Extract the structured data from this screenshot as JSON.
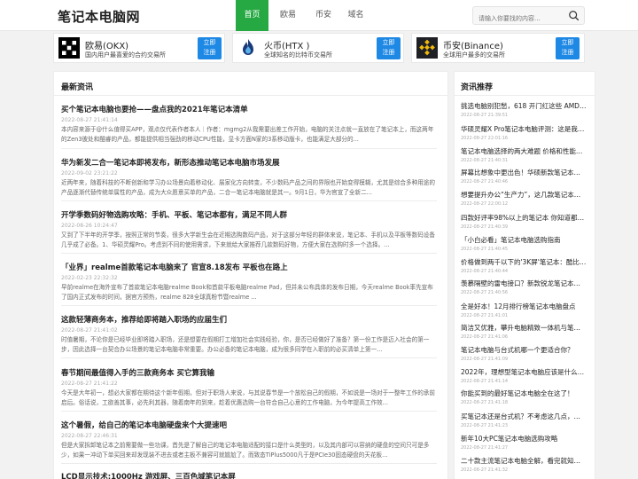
{
  "site": {
    "logo": "笔记本电脑网"
  },
  "nav": {
    "items": [
      "首页",
      "欧易",
      "币安",
      "域名"
    ]
  },
  "search": {
    "placeholder": "请输入你要找的内容..."
  },
  "exchanges": [
    {
      "name": "欧易(OKX)",
      "desc": "国内用户最喜爱的合约交易所",
      "button": [
        "立即",
        "注册"
      ]
    },
    {
      "name": "火币(HTX )",
      "desc": "全球知名的比特币交易所",
      "button": [
        "立即",
        "注册"
      ]
    },
    {
      "name": "币安(Binance)",
      "desc": "全球用户最多的交易所",
      "button": [
        "立即",
        "注册"
      ]
    }
  ],
  "latest": {
    "title": "最新资讯",
    "articles": [
      {
        "title": "买个笔记本电脑也要抢——盘点我的2021年笔记本清单",
        "date": "2022-08-27 21:41:14",
        "summary": "本内容来源于@什么值得买APP，观点仅代表作者本人｜作者：mgmg2从我需要出差工作开始，电脑的关注点就一直放在了笔记本上，而这两年的Zen3彼处和酷睿的产品，都能提供相当强劲的移动CPU性能，显卡方面N家的3系移动版卡，也能满足大部分的..."
      },
      {
        "title": "华为新发二合一笔记本即将发布，新形态推动笔记本电脑市场发展",
        "date": "2022-09-02 23:21:22",
        "summary": "近两年来，随着科技的不断创新和学习办公场景向着移动化、展家化方向转变，不少数码产品之间的界限也开始变得模糊，尤其是综合多种用途的产品逐渐代替传统单属性的产品，成为大众愿意买单的产品，二合一笔记本电脑就是其一。9月1日，华为官宣了全新二..."
      },
      {
        "title": "开学季数码好物选购攻略：手机、平板、笔记本都有，满足不同人群",
        "date": "2022-08-26 10:24:47",
        "summary": "又到了下半年的开学季，按照正常的节奏，很多大学新生会在近期选购数码产品，对于这部分年轻的群体来说，笔记本、手机以及平板等数码设备几乎成了必备。1、华硕灵耀Pro。考虑到不同的使用需求，下来就给大家推荐几款数码好物，方便大家在选购时多一个选择。..."
      },
      {
        "title": "「业界」realme首款笔记本电脑来了 官宣8.18发布 平板也在路上",
        "date": "2022-02-23 22:32:32",
        "summary": "早前realme在海外宣布了首款笔记本电脑realme Book和首款平板电脑realme Pad，但并未公布具体的发布日期，今天realme Book率先宣布了国内正式发布的时间，据官方预热，realme 828全球真粉节暨realme ..."
      },
      {
        "title": "这款轻薄商务本，推荐给即将踏入职场的应届生们",
        "date": "2022-08-27 21:41:02",
        "summary": "时值暑期，不论你是已经毕业即将踏入职场，还是想要在假期打工增加社会实践经验，你，是否已经做好了准备？第一份工作是迈入社会的第一步，因此选择一台契合办公场景的笔记本电脑非常重要。办公必备的笔记本电脑，成为很多同学在入职前的必买清单上第一..."
      },
      {
        "title": "春节期间最值得入手的三款商务本 买它算我输",
        "date": "2022-08-27 21:41:22",
        "summary": "今天是大年初一，想必大家都在期待这个新年假期，但对于职场人来说，与其说春节是一个放松自己的假期，不如说是一场对于一整年工作的承前启后。俗话说，工欲善其事，必先利其器，随着南年的到来，趁着优惠选购一台符合自己心意的工作电脑，为今年提高工作效..."
      },
      {
        "title": "这个暑假，给自己的笔记本电脑硬盘来个大提速吧",
        "date": "2022-08-27 22:46:31",
        "summary": "但是大家拆卸笔记本之前需要做一些功课，首先是了解自己的笔记本电脑适配的接口是什么类型的，以及其内部可以容纳的硬盘的空间只可是多少，如果一冲动下单买回来却发现装不进去或者主板不兼容可就尴尬了。而致态TiPlus5000凡于是PCIe30固态硬盘的天花板..."
      },
      {
        "title": "LCD显示技术:1000Hz 游戏屏、三百色域笔记本屏",
        "date": "",
        "summary": ""
      }
    ]
  },
  "recommend": {
    "title": "资讯推荐",
    "items": [
      {
        "title": "挑选电脑别犯愁，618 开门红这些 AMD笔记本...",
        "date": "2022-08-27 21:39:51"
      },
      {
        "title": "华硕灵耀X Pro笔记本电脑评测：这是我见过...",
        "date": "2022-08-27 22:01:16"
      },
      {
        "title": "笔记本电脑选择的两大难题 价格和性能如何权衡",
        "date": "2022-08-27 21:40:31"
      },
      {
        "title": "屏幕比想象中更出色！华硕新款笔记本电脑体...",
        "date": "2022-08-27 21:40:46"
      },
      {
        "title": "想要提升办公“生产力”，这几款笔记本电脑...",
        "date": "2022-08-27 22:00:12"
      },
      {
        "title": "四款好评率98%以上的笔记本 你知道都有哪些...",
        "date": "2022-08-27 21:40:39"
      },
      {
        "title": "「小白必看」笔记本电脑选购指南",
        "date": "2022-08-27 21:40:45"
      },
      {
        "title": "价格做到两千以下的'3K屏'笔记本：酷比魔方...",
        "date": "2022-08-27 21:40:44"
      },
      {
        "title": "羡慕隔壁的雷电接口？新款锐龙笔记本电脑安排...",
        "date": "2022-08-27 21:40:56"
      },
      {
        "title": "全是好本！12月排行榜笔记本电脑盘点",
        "date": "2022-08-27 21:41:01"
      },
      {
        "title": "简洁又优雅，攀升电脑精致一体机与笔记本电脑...",
        "date": "2022-08-27 21:41:06"
      },
      {
        "title": "笔记本电脑与台式机哪一个更适合你？",
        "date": "2022-08-27 21:41:09"
      },
      {
        "title": "2022年，理想型笔记本电脑应该是什么样的？",
        "date": "2022-08-27 21:41:14"
      },
      {
        "title": "你能买到的最好笔记本电脑全在这了！",
        "date": "2022-08-27 21:41:18"
      },
      {
        "title": "买笔记本还是台式机？不考虑这几点，买了也是白买",
        "date": "2022-08-27 21:41:23"
      },
      {
        "title": "新年10大PC笔记本电脑选购攻略",
        "date": "2022-08-27 21:41:27"
      },
      {
        "title": "二十款主流笔记本电脑全解，看完就知道怎么买",
        "date": "2022-08-27 21:41:32"
      }
    ]
  },
  "colors": {
    "accent": "#26a943",
    "button": "#1e88e5"
  }
}
